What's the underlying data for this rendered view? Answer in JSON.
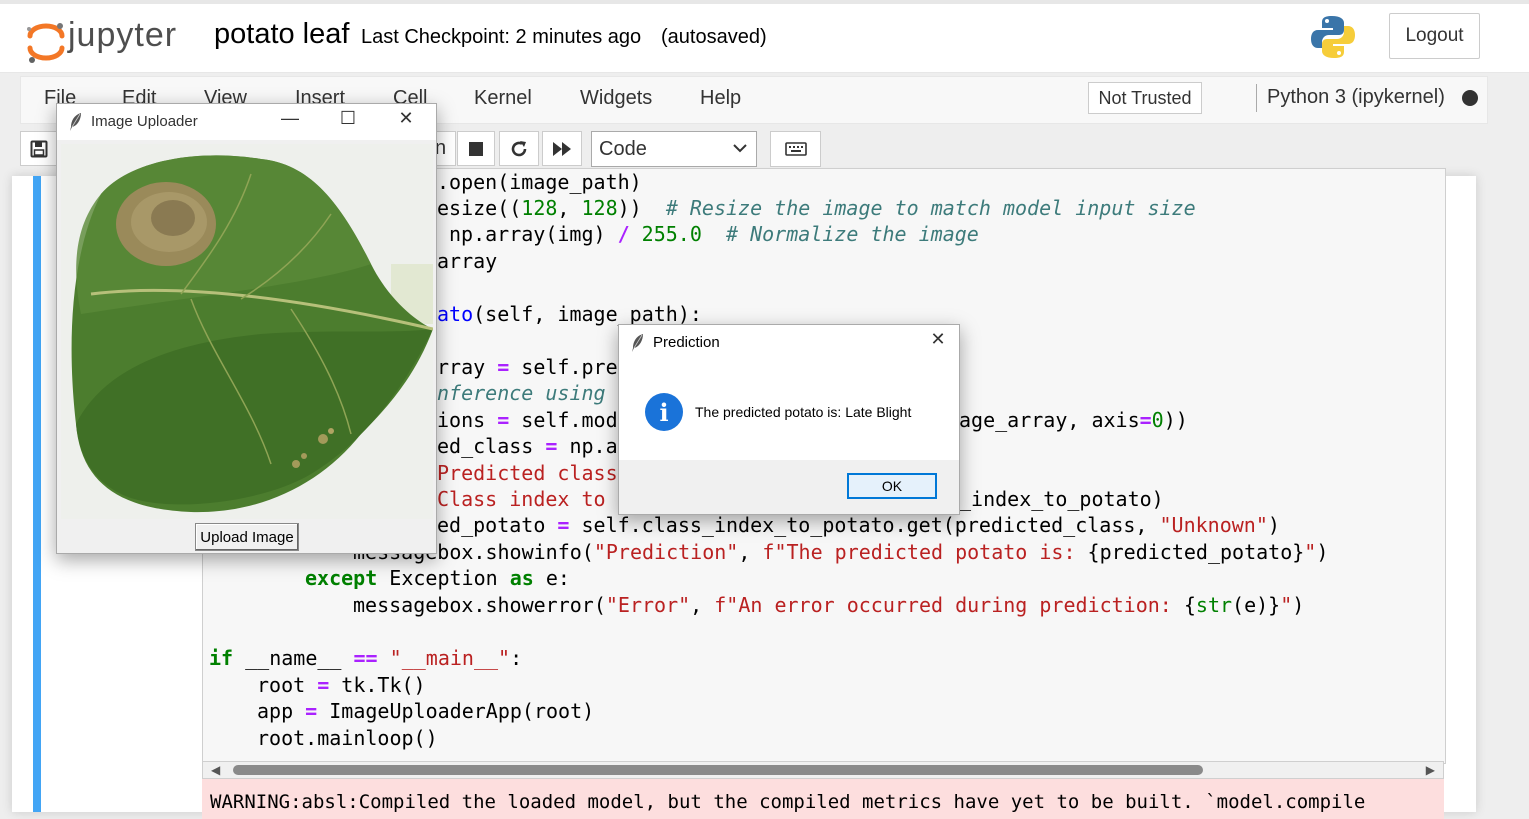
{
  "header": {
    "logo_text": "jupyter",
    "notebook_title": "potato leaf",
    "checkpoint": "Last Checkpoint: 2 minutes ago",
    "autosave_status": "(autosaved)",
    "logout_label": "Logout"
  },
  "menubar": {
    "items": [
      "File",
      "Edit",
      "View",
      "Insert",
      "Cell",
      "Kernel",
      "Widgets",
      "Help"
    ],
    "trust_label": "Not Trusted",
    "kernel_name": "Python 3 (ipykernel)"
  },
  "toolbar": {
    "cell_type": "Code",
    "partial_run_label": "n"
  },
  "code": {
    "l1": ".open(image_path)",
    "l2a": "esize((",
    "l2b": "128",
    "l2c": ", ",
    "l2d": "128",
    "l2e": "))  ",
    "l2f": "# Resize the image to match model input size",
    "l3a": "np.array(img) ",
    "l3b": "/",
    "l3c": " ",
    "l3d": "255.0",
    "l3e": "  ",
    "l3f": "# Normalize the image",
    "l4": "array",
    "l5a": "ato",
    "l5b": "(self, image_path):",
    "l6a": "rray ",
    "l6b": "=",
    "l6c": " self.pre",
    "l7": "nference using",
    "l8a": "ions ",
    "l8b": "=",
    "l8c": " self.mod",
    "l8d": "age_array, axis",
    "l8e": "=",
    "l8f": "0",
    "l8g": "))",
    "l9a": "ed_class ",
    "l9b": "=",
    "l9c": " np.a",
    "l10": "Predicted class",
    "l11a": "Class index to",
    "l11b": "_index_to_potato)",
    "l12a": "ed_potato ",
    "l12b": "=",
    "l12c": " self.class_index_to_potato.get(predicted_class, ",
    "l12d": "\"Unknown\"",
    "l12e": ")",
    "l13a": "messagebox.showinfo(",
    "l13b": "\"Prediction\"",
    "l13c": ", ",
    "l13d": "f\"The predicted potato is: ",
    "l13e": "{predicted_potato}",
    "l13f": "\"",
    "l13g": ")",
    "l14a": "except",
    "l14b": " Exception ",
    "l14c": "as",
    "l14d": " e:",
    "l15a": "messagebox.showerror(",
    "l15b": "\"Error\"",
    "l15c": ", ",
    "l15d": "f\"An error occurred during prediction: ",
    "l15e": "{",
    "l15f": "str",
    "l15g": "(e)}",
    "l15h": "\"",
    "l15i": ")",
    "l16a": "if",
    "l16b": " __name__ ",
    "l16c": "==",
    "l16d": " ",
    "l16e": "\"__main__\"",
    "l16f": ":",
    "l17a": "root ",
    "l17b": "=",
    "l17c": " tk.Tk()",
    "l18a": "app ",
    "l18b": "=",
    "l18c": " ImageUploaderApp(root)",
    "l19": "root.mainloop()"
  },
  "output": {
    "warning": "WARNING:absl:Compiled the loaded model, but the compiled metrics have yet to be built. `model.compile"
  },
  "uploader_window": {
    "title": "Image Uploader",
    "button_label": "Upload Image"
  },
  "prediction_dialog": {
    "title": "Prediction",
    "message": "The predicted potato is: Late Blight",
    "ok_label": "OK"
  },
  "colors": {
    "accent": "#42a5f5",
    "jupyter_orange": "#f37726",
    "warning_bg": "#fddede"
  }
}
